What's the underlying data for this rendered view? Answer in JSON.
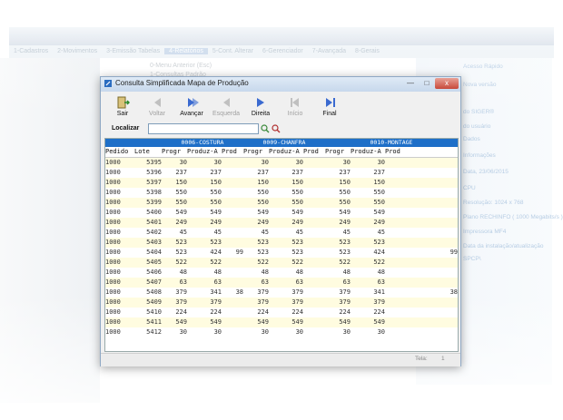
{
  "background": {
    "menubar": [
      "1-Cadastros",
      "2-Movimentos",
      "3-Emissão Tabelas",
      "4-Relatórios",
      "5-Cont. Alterar",
      "6-Gerenciador",
      "7-Avançada",
      "8-Gerais"
    ],
    "active_menu_index": 3,
    "submenu": [
      "0-Menu Anterior (Esc)",
      "1-Consultas Padrão"
    ],
    "right_panel": [
      "Acesso Rápido",
      "Nova versão",
      "do SIGER®",
      "do usuário",
      "Dados",
      "Informações",
      "Data, 23/06/2015",
      "CPU",
      "Resolução: 1024 x 768",
      "Plano RECHINFO ( 1000 Megabits/s )",
      "Impressora MF4",
      "Data da instalação/atualização",
      "SPCP\\"
    ]
  },
  "dialog": {
    "title": "Consulta Simplificada Mapa de Produção",
    "close_label": "x"
  },
  "toolbar": {
    "buttons": [
      {
        "label": "Sair",
        "enabled": true,
        "icon": "exit-icon"
      },
      {
        "label": "Voltar",
        "enabled": false,
        "icon": "back-icon"
      },
      {
        "label": "Avançar",
        "enabled": true,
        "icon": "forward-icon"
      },
      {
        "label": "Esquerda",
        "enabled": false,
        "icon": "left-icon"
      },
      {
        "label": "Direita",
        "enabled": true,
        "icon": "right-icon"
      },
      {
        "label": "Início",
        "enabled": false,
        "icon": "home-icon"
      },
      {
        "label": "Final",
        "enabled": true,
        "icon": "end-icon"
      }
    ]
  },
  "search": {
    "label": "Localizar",
    "value": ""
  },
  "grid": {
    "groups": [
      "0006-COSTURA",
      "0009-CHANFRA",
      "0010-MONTAGE"
    ],
    "headers": [
      "Pedido",
      "Lote",
      "Progr",
      "Produz-A",
      "Prod",
      "Progr",
      "Produz-A",
      "Prod",
      "Progr",
      "Produz-A",
      "Prod"
    ],
    "rows": [
      [
        "1000",
        "5395",
        "30",
        "30",
        "",
        "30",
        "30",
        "",
        "30",
        "30",
        ""
      ],
      [
        "1000",
        "5396",
        "237",
        "237",
        "",
        "237",
        "237",
        "",
        "237",
        "237",
        ""
      ],
      [
        "1000",
        "5397",
        "150",
        "150",
        "",
        "150",
        "150",
        "",
        "150",
        "150",
        ""
      ],
      [
        "1000",
        "5398",
        "550",
        "550",
        "",
        "550",
        "550",
        "",
        "550",
        "550",
        ""
      ],
      [
        "1000",
        "5399",
        "550",
        "550",
        "",
        "550",
        "550",
        "",
        "550",
        "550",
        ""
      ],
      [
        "1000",
        "5400",
        "549",
        "549",
        "",
        "549",
        "549",
        "",
        "549",
        "549",
        ""
      ],
      [
        "1000",
        "5401",
        "249",
        "249",
        "",
        "249",
        "249",
        "",
        "249",
        "249",
        ""
      ],
      [
        "1000",
        "5402",
        "45",
        "45",
        "",
        "45",
        "45",
        "",
        "45",
        "45",
        ""
      ],
      [
        "1000",
        "5403",
        "523",
        "523",
        "",
        "523",
        "523",
        "",
        "523",
        "523",
        ""
      ],
      [
        "1000",
        "5404",
        "523",
        "424",
        "99",
        "523",
        "523",
        "",
        "523",
        "424",
        "99"
      ],
      [
        "1000",
        "5405",
        "522",
        "522",
        "",
        "522",
        "522",
        "",
        "522",
        "522",
        ""
      ],
      [
        "1000",
        "5406",
        "48",
        "48",
        "",
        "48",
        "48",
        "",
        "48",
        "48",
        ""
      ],
      [
        "1000",
        "5407",
        "63",
        "63",
        "",
        "63",
        "63",
        "",
        "63",
        "63",
        ""
      ],
      [
        "1000",
        "5408",
        "379",
        "341",
        "38",
        "379",
        "379",
        "",
        "379",
        "341",
        "38"
      ],
      [
        "1000",
        "5409",
        "379",
        "379",
        "",
        "379",
        "379",
        "",
        "379",
        "379",
        ""
      ],
      [
        "1000",
        "5410",
        "224",
        "224",
        "",
        "224",
        "224",
        "",
        "224",
        "224",
        ""
      ],
      [
        "1000",
        "5411",
        "549",
        "549",
        "",
        "549",
        "549",
        "",
        "549",
        "549",
        ""
      ],
      [
        "1000",
        "5412",
        "30",
        "30",
        "",
        "30",
        "30",
        "",
        "30",
        "30",
        ""
      ]
    ]
  },
  "status": {
    "label": "Tela:",
    "value": "1"
  }
}
